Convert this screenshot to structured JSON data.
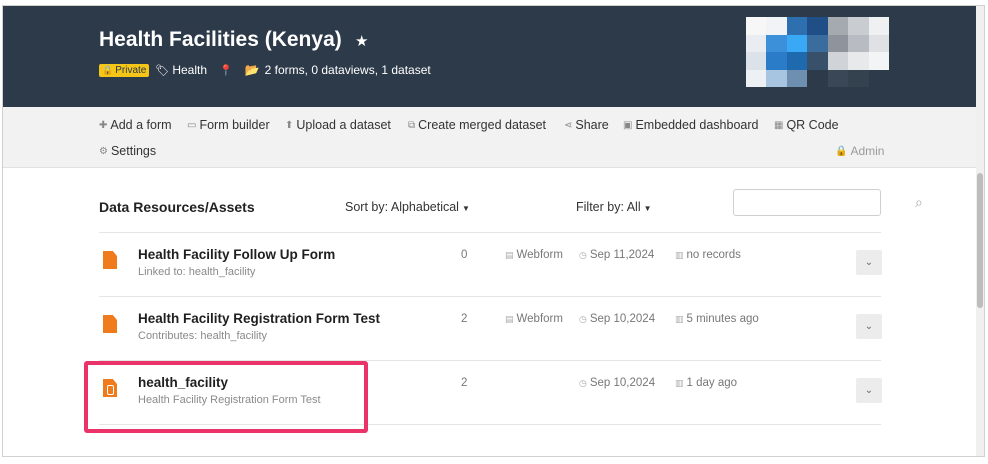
{
  "header": {
    "title": "Health Facilities (Kenya)",
    "private_label": "Private",
    "tag_label": "Health",
    "summary": "2 forms, 0 dataviews, 1 dataset",
    "icons": [
      "star-icon",
      "lock-icon",
      "tag-icon",
      "map-pin-icon",
      "folder-icon"
    ],
    "background_color": "#2d3a4a",
    "private_badge_color": "#f5c518"
  },
  "toolbar": {
    "add_form": "Add a form",
    "form_builder": "Form builder",
    "upload_dataset": "Upload a dataset",
    "create_merged": "Create merged dataset",
    "share": "Share",
    "embedded_dashboard": "Embedded dashboard",
    "qr_code": "QR Code",
    "settings": "Settings",
    "admin": "Admin"
  },
  "resources": {
    "title": "Data Resources/Assets",
    "sort_prefix": "Sort by: ",
    "sort_value": "Alphabetical",
    "filter_prefix": "Filter by: ",
    "filter_value": "All",
    "search_value": ""
  },
  "rows": [
    {
      "title": "Health Facility Follow Up Form",
      "subtitle": "Linked to: health_facility",
      "count": "0",
      "type": "Webform",
      "date": "Sep 11,2024",
      "records": "no records",
      "kind": "form"
    },
    {
      "title": "Health Facility Registration Form Test",
      "subtitle": "Contributes: health_facility",
      "count": "2",
      "type": "Webform",
      "date": "Sep 10,2024",
      "records": "5 minutes ago",
      "kind": "form"
    },
    {
      "title": "health_facility",
      "subtitle": "Health Facility Registration Form Test",
      "count": "2",
      "type": "",
      "date": "Sep 10,2024",
      "records": "1 day ago",
      "kind": "dataset"
    }
  ],
  "accent_color": "#f07b1d",
  "highlight_color": "#ea3369"
}
